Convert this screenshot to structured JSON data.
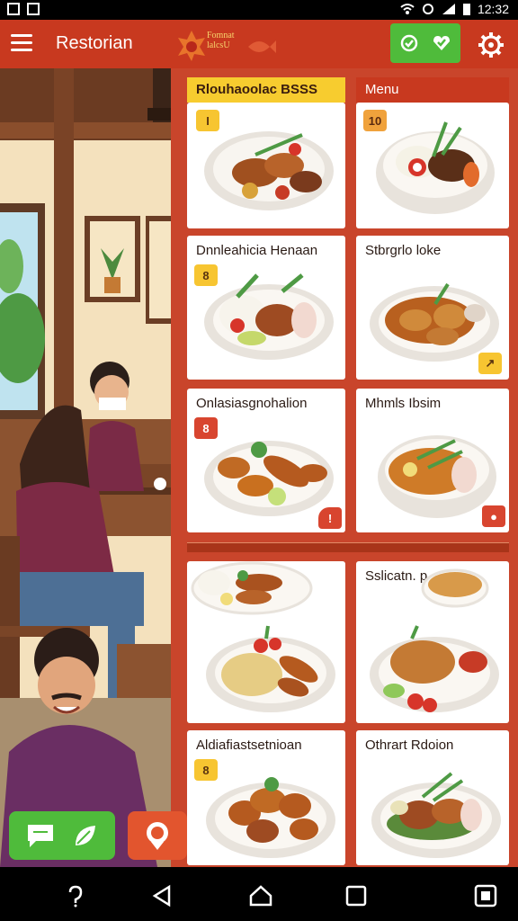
{
  "status_bar": {
    "time": "12:32"
  },
  "app_bar": {
    "menu_icon": "hamburger-icon",
    "title": "Restorian",
    "logo_text_line1": "Fomnat",
    "logo_text_line2": "lalcsU",
    "action_icons": [
      "chat-check-icon",
      "heart-check-icon"
    ],
    "settings_icon": "gear-icon"
  },
  "banners": {
    "left": "Rlouhaoolac BSSS",
    "right": "Menu"
  },
  "cards": [
    {
      "title": "",
      "badge": "I",
      "badge_color": "#f7c531"
    },
    {
      "title": "",
      "badge": "10",
      "badge_color": "#f0a23c"
    },
    {
      "title": "Dnnleahicia Henaan",
      "badge": "8",
      "badge_color": "#f7c531"
    },
    {
      "title": "Stbrgrlo loke",
      "badge": "",
      "badge_color": "#f7c531"
    },
    {
      "title": "Onlasiasgnohalion",
      "badge": "8",
      "badge_color": "#d8452f"
    },
    {
      "title": "Mhmls Ibsim",
      "badge": "",
      "badge_color": "#d8452f"
    },
    {
      "title": "",
      "badge": "",
      "badge_color": ""
    },
    {
      "title": "Sslicatn. p",
      "badge": "",
      "badge_color": ""
    },
    {
      "title": "Aldiafiastsetnioan",
      "badge": "8",
      "badge_color": "#f7c531"
    },
    {
      "title": "Othrart Rdoion",
      "badge": "",
      "badge_color": ""
    }
  ],
  "bottom_buttons": {
    "chat_icon": "chat-icon",
    "leaf_icon": "leaf-icon",
    "pin_icon": "location-pin-icon"
  },
  "nav_bar": {
    "icons": [
      "voice-icon",
      "back-icon",
      "home-icon",
      "recents-icon",
      "screenshot-icon"
    ]
  }
}
